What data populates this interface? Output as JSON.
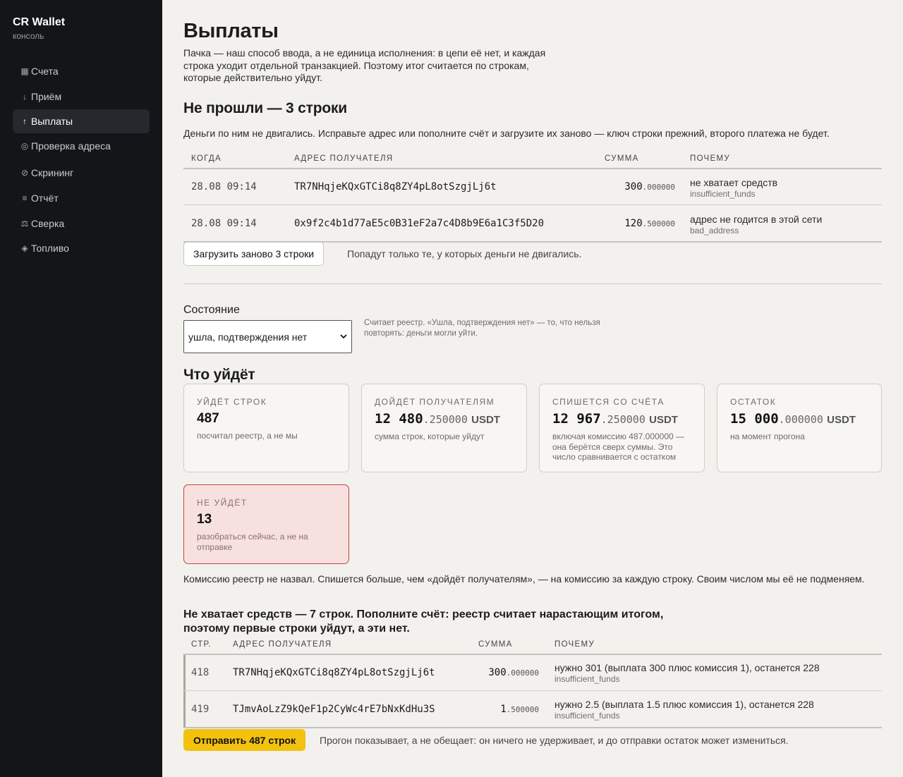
{
  "sidebar": {
    "brand": "CR Wallet",
    "subtitle": "консоль",
    "items": [
      {
        "icon": "▦",
        "label": "Счета"
      },
      {
        "icon": "↓",
        "label": "Приём"
      },
      {
        "icon": "↑",
        "label": "Выплаты"
      },
      {
        "icon": "◎",
        "label": "Проверка адреса"
      },
      {
        "icon": "⊘",
        "label": "Скрининг"
      },
      {
        "icon": "≡",
        "label": "Отчёт"
      },
      {
        "icon": "⚖",
        "label": "Сверка"
      },
      {
        "icon": "◈",
        "label": "Топливо"
      }
    ],
    "active_item": "Выплаты"
  },
  "page": {
    "title": "Выплаты",
    "intro": "Пачка — наш способ ввода, а не единица исполнения: в цепи её нет, и каждая строка уходит отдельной транзакцией. Поэтому итог считается по строкам, которые действительно уйдут."
  },
  "failed": {
    "heading": "Не прошли — 3 строки",
    "description": "Деньги по ним не двигались. Исправьте адрес или пополните счёт и загрузите их заново — ключ строки прежний, второго платежа не будет.",
    "columns": [
      "Когда",
      "Адрес получателя",
      "Сумма",
      "Почему"
    ],
    "rows": [
      {
        "date": "28.08 09:14",
        "address": "TR7NHqjeKQxGTCi8q8ZY4pL8otSzgjLj6t",
        "amount_int": "300",
        "amount_dec": ".000000",
        "reason": "не хватает средств",
        "code": "insufficient_funds"
      },
      {
        "date": "28.08 09:14",
        "address": "0x9f2c4b1d77aE5c0B31eF2a7c4D8b9E6a1C3f5D20",
        "amount_int": "120",
        "amount_dec": ".500000",
        "reason": "адрес не годится в этой сети",
        "code": "bad_address"
      }
    ],
    "reload_button": "Загрузить заново 3 строки",
    "reload_note": "Попадут только те, у которых деньги не двигались."
  },
  "state": {
    "label": "Состояние",
    "selected": "ушла, подтверждения нет",
    "hint": "Считает реестр. «Ушла, подтверждения нет» — то, что нельзя повторять: деньги могли уйти."
  },
  "outgoing": {
    "heading": "Что уйдёт",
    "cards": [
      {
        "label": "Уйдёт строк",
        "value_int": "487",
        "value_dec": "",
        "unit": "",
        "sub": "посчитал реестр, а не мы"
      },
      {
        "label": "Дойдёт получателям",
        "value_int": "12 480",
        "value_dec": ".250000",
        "unit": "USDT",
        "sub": "сумма строк, которые уйдут"
      },
      {
        "label": "Спишется со счёта",
        "value_int": "12 967",
        "value_dec": ".250000",
        "unit": "USDT",
        "sub": "включая комиссию 487.000000 — она берётся сверх суммы. Это число сравнивается с остатком"
      },
      {
        "label": "Остаток",
        "value_int": "15 000",
        "value_dec": ".000000",
        "unit": "USDT",
        "sub": "на момент прогона"
      }
    ],
    "not_going": {
      "label": "Не уйдёт",
      "value": "13",
      "sub": "разобраться сейчас, а не на отправке"
    },
    "fee_note": "Комиссию реестр не назвал. Спишется больше, чем «дойдёт получателям», — на комиссию за каждую строку. Своим числом мы её не подменяем."
  },
  "insufficient": {
    "heading": "Не хватает средств — 7 строк. Пополните счёт: реестр считает нарастающим итогом, поэтому первые строки уйдут, а эти нет.",
    "columns": [
      "Стр.",
      "Адрес получателя",
      "Сумма",
      "Почему"
    ],
    "rows": [
      {
        "line": "418",
        "address": "TR7NHqjeKQxGTCi8q8ZY4pL8otSzgjLj6t",
        "amount_int": "300",
        "amount_dec": ".000000",
        "reason": "нужно 301 (выплата 300 плюс комиссия 1), останется 228",
        "code": "insufficient_funds"
      },
      {
        "line": "419",
        "address": "TJmvAoLzZ9kQeF1p2CyWc4rE7bNxKdHu3S",
        "amount_int": "1",
        "amount_dec": ".500000",
        "reason": "нужно 2.5 (выплата 1.5 плюс комиссия 1), останется 228",
        "code": "insufficient_funds"
      }
    ]
  },
  "footer": {
    "send_button": "Отправить 487 строк",
    "note": "Прогон показывает, а не обещает: он ничего не удерживает, и до отправки остаток может измениться."
  },
  "colors": {
    "sidebar_bg": "#131518",
    "page_bg": "#f2f1ed",
    "accent_yellow": "#f2c20f",
    "danger_border": "#c9433f",
    "danger_bg": "#f7e1df"
  }
}
